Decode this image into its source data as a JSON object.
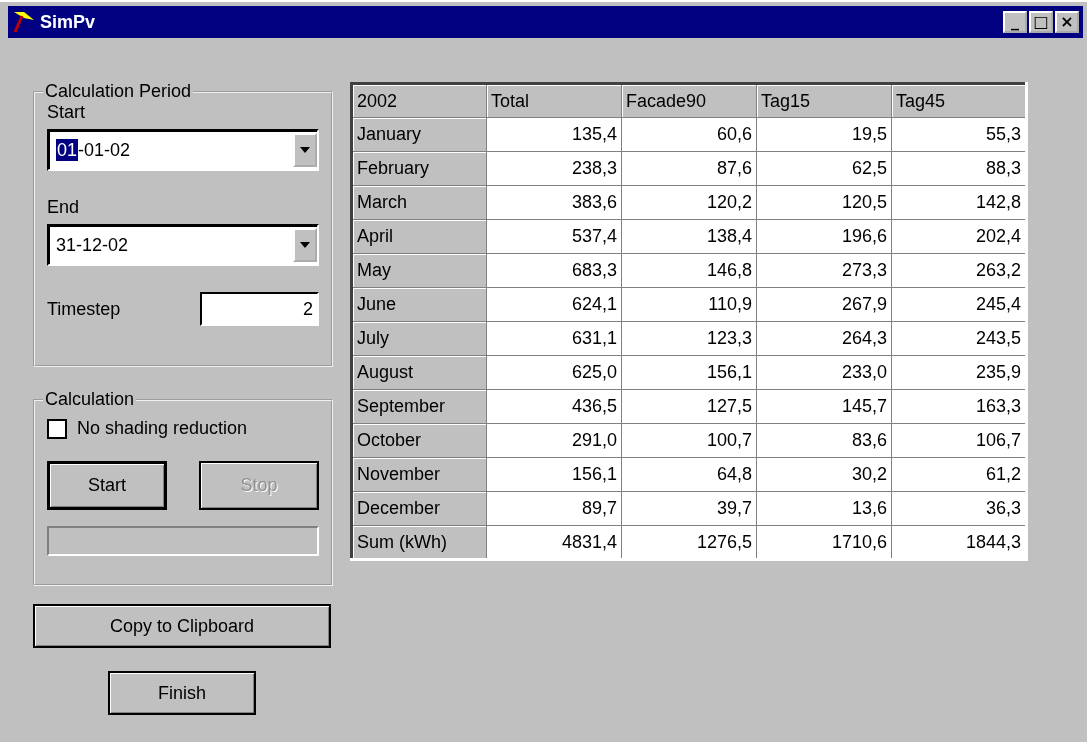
{
  "window": {
    "title": "SimPv",
    "controls": [
      "_",
      "□",
      "×"
    ]
  },
  "calculation_period": {
    "legend": "Calculation Period",
    "start": {
      "label": "Start",
      "value_selected": "01",
      "value_rest": "-01-02"
    },
    "end": {
      "label": "End",
      "value": "31-12-02"
    },
    "timestep": {
      "label": "Timestep",
      "value": "2"
    }
  },
  "calculation": {
    "legend": "Calculation",
    "no_shading": {
      "label": "No shading reduction",
      "checked": false
    },
    "buttons": [
      {
        "label": "Start",
        "default": true,
        "disabled": false
      },
      {
        "label": "Stop",
        "default": false,
        "disabled": true
      }
    ],
    "progress": {
      "level": 0
    }
  },
  "copy_button": "Copy to Clipboard",
  "finish_button": "Finish",
  "table": {
    "columns": [
      "2002",
      "Total",
      "Facade90",
      "Tag15",
      "Tag45"
    ],
    "rows": [
      [
        "January",
        "135,4",
        "60,6",
        "19,5",
        "55,3"
      ],
      [
        "February",
        "238,3",
        "87,6",
        "62,5",
        "88,3"
      ],
      [
        "March",
        "383,6",
        "120,2",
        "120,5",
        "142,8"
      ],
      [
        "April",
        "537,4",
        "138,4",
        "196,6",
        "202,4"
      ],
      [
        "May",
        "683,3",
        "146,8",
        "273,3",
        "263,2"
      ],
      [
        "June",
        "624,1",
        "110,9",
        "267,9",
        "245,4"
      ],
      [
        "July",
        "631,1",
        "123,3",
        "264,3",
        "243,5"
      ],
      [
        "August",
        "625,0",
        "156,1",
        "233,0",
        "235,9"
      ],
      [
        "September",
        "436,5",
        "127,5",
        "145,7",
        "163,3"
      ],
      [
        "October",
        "291,0",
        "100,7",
        "83,6",
        "106,7"
      ],
      [
        "November",
        "156,1",
        "64,8",
        "30,2",
        "61,2"
      ],
      [
        "December",
        "89,7",
        "39,7",
        "13,6",
        "36,3"
      ],
      [
        "Sum (kWh)",
        "4831,4",
        "1276,5",
        "1710,6",
        "1844,3"
      ]
    ]
  }
}
